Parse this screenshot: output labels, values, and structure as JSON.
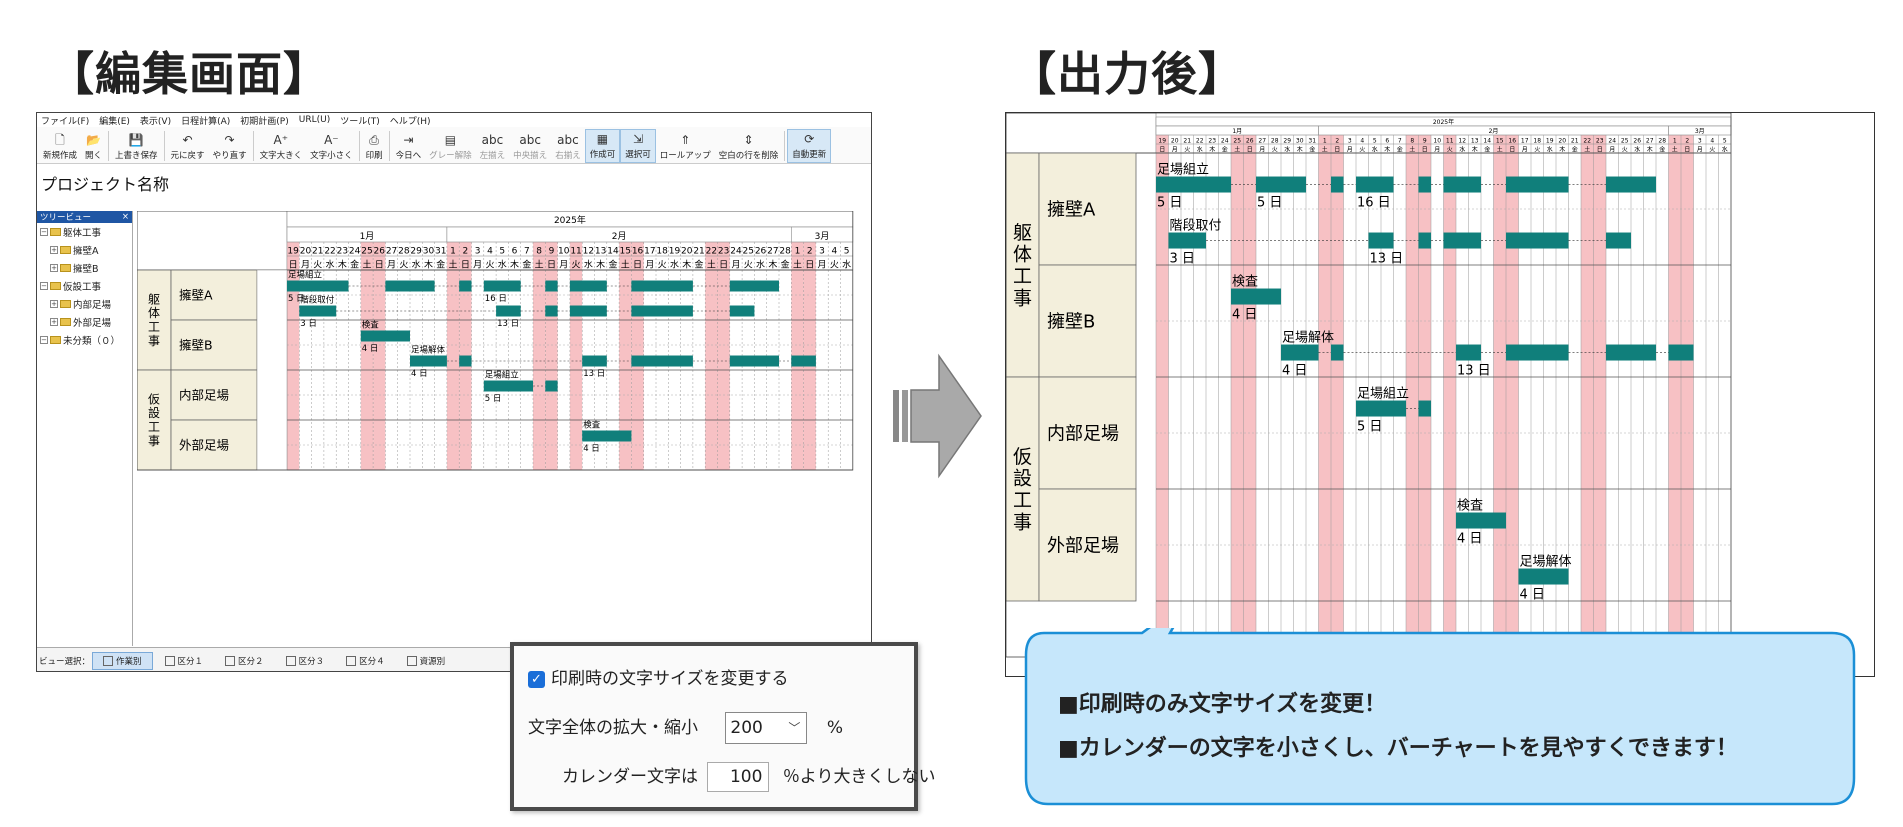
{
  "headings": {
    "left": "【編集画面】",
    "right": "【出力後】"
  },
  "menu": [
    "ファイル(F)",
    "編集(E)",
    "表示(V)",
    "日程計算(A)",
    "初期計画(P)",
    "URL(U)",
    "ツール(T)",
    "ヘルプ(H)"
  ],
  "toolbar": [
    {
      "label": "新規作成",
      "icon": "🗋",
      "state": "normal"
    },
    {
      "label": "開く",
      "icon": "📂",
      "state": "normal"
    },
    {
      "sep": true
    },
    {
      "label": "上書き保存",
      "icon": "💾",
      "state": "normal"
    },
    {
      "sep": true
    },
    {
      "label": "元に戻す",
      "icon": "↶",
      "state": "normal"
    },
    {
      "label": "やり直す",
      "icon": "↷",
      "state": "normal"
    },
    {
      "sep": true
    },
    {
      "label": "文字大きく",
      "icon": "A⁺",
      "state": "normal"
    },
    {
      "label": "文字小さく",
      "icon": "A⁻",
      "state": "normal"
    },
    {
      "sep": true
    },
    {
      "label": "印刷",
      "icon": "⎙",
      "state": "normal"
    },
    {
      "sep": true
    },
    {
      "label": "今日へ",
      "icon": "⇥",
      "state": "normal"
    },
    {
      "label": "グレー解除",
      "icon": "▤",
      "state": "gray"
    },
    {
      "label": "左揃え",
      "icon": "abc",
      "state": "gray"
    },
    {
      "label": "中央揃え",
      "icon": "abc",
      "state": "gray"
    },
    {
      "label": "右揃え",
      "icon": "abc",
      "state": "gray"
    },
    {
      "label": "作成可",
      "icon": "▦",
      "state": "active"
    },
    {
      "label": "選択可",
      "icon": "⇲",
      "state": "active"
    },
    {
      "label": "ロールアップ",
      "icon": "⇑",
      "state": "normal"
    },
    {
      "label": "空白の行を削除",
      "icon": "⇕",
      "state": "normal"
    },
    {
      "sep": true
    },
    {
      "label": "自動更新",
      "icon": "⟳",
      "state": "active"
    }
  ],
  "project_name": "プロジェクト名称",
  "tree": {
    "title": "ツリービュー",
    "close": "×",
    "items": [
      {
        "label": "躯体工事",
        "level": 0,
        "pm": "−"
      },
      {
        "label": "擁壁A",
        "level": 1,
        "pm": "+"
      },
      {
        "label": "擁壁B",
        "level": 1,
        "pm": "+"
      },
      {
        "label": "仮設工事",
        "level": 0,
        "pm": "−"
      },
      {
        "label": "内部足場",
        "level": 1,
        "pm": "+"
      },
      {
        "label": "外部足場",
        "level": 1,
        "pm": "+"
      },
      {
        "label": "未分類（０）",
        "level": 0,
        "pm": "−"
      }
    ]
  },
  "calendar": {
    "year": "2025年",
    "months": [
      {
        "label": "1月",
        "days": 13
      },
      {
        "label": "2月",
        "days": 28
      },
      {
        "label": "3月",
        "days": 5
      }
    ],
    "days": [
      19,
      20,
      21,
      22,
      23,
      24,
      25,
      26,
      27,
      28,
      29,
      30,
      31,
      1,
      2,
      3,
      4,
      5,
      6,
      7,
      8,
      9,
      10,
      11,
      12,
      13,
      14,
      15,
      16,
      17,
      18,
      19,
      20,
      21,
      22,
      23,
      24,
      25,
      26,
      27,
      28,
      1,
      2,
      3,
      4,
      5
    ],
    "weekdays": [
      "日",
      "月",
      "火",
      "水",
      "木",
      "金",
      "土",
      "日",
      "月",
      "火",
      "水",
      "木",
      "金",
      "土",
      "日",
      "月",
      "火",
      "水",
      "木",
      "金",
      "土",
      "日",
      "月",
      "火",
      "水",
      "木",
      "金",
      "土",
      "日",
      "月",
      "火",
      "水",
      "木",
      "金",
      "土",
      "日",
      "月",
      "火",
      "水",
      "木",
      "金",
      "土",
      "日",
      "月",
      "火",
      "水"
    ],
    "holidays": [
      0,
      6,
      7,
      13,
      14,
      20,
      21,
      23,
      27,
      28,
      34,
      35,
      41,
      42
    ]
  },
  "groups": [
    {
      "name": "躯体工事",
      "sub": [
        {
          "name": "擁壁A"
        },
        {
          "name": "擁壁B"
        }
      ]
    },
    {
      "name": "仮設工事",
      "sub": [
        {
          "name": "内部足場"
        },
        {
          "name": "外部足場"
        }
      ]
    }
  ],
  "tasks": [
    {
      "label": "足場組立",
      "dur": "5 日",
      "row": 0,
      "start": 0,
      "segs": [
        [
          0,
          5
        ],
        [
          8,
          12
        ],
        [
          14,
          15
        ],
        [
          16,
          19
        ],
        [
          21,
          22
        ],
        [
          23,
          26
        ],
        [
          28,
          33
        ],
        [
          36,
          40
        ]
      ],
      "dur2": "16 日",
      "dur2_at": 16
    },
    {
      "label": "階段取付",
      "dur": "3 日",
      "row": 1,
      "start": 1,
      "segs": [
        [
          1,
          4
        ],
        [
          17,
          19
        ],
        [
          21,
          22
        ],
        [
          23,
          26
        ],
        [
          28,
          33
        ],
        [
          36,
          38
        ]
      ],
      "dur2": "13 日",
      "dur2_at": 17
    },
    {
      "label": "検査",
      "dur": "4 日",
      "row": 2,
      "start": 6,
      "segs": [
        [
          6,
          10
        ]
      ]
    },
    {
      "label": "足場解体",
      "dur": "4 日",
      "row": 3,
      "start": 10,
      "segs": [
        [
          10,
          13
        ],
        [
          14,
          15
        ],
        [
          24,
          26
        ],
        [
          28,
          33
        ],
        [
          36,
          40
        ],
        [
          41,
          43
        ]
      ],
      "dur2": "13 日",
      "dur2_at": 24
    },
    {
      "label": "足場組立",
      "dur": "5 日",
      "row": 4,
      "start": 16,
      "segs": [
        [
          16,
          20
        ],
        [
          21,
          22
        ]
      ]
    },
    {
      "label": "検査",
      "dur": "4 日",
      "row": 6,
      "start": 24,
      "segs": [
        [
          24,
          28
        ]
      ]
    }
  ],
  "out_tasks": [
    {
      "label": "足場組立",
      "dur": "5 日",
      "row": 0,
      "segs": [
        [
          0,
          6
        ],
        [
          8,
          12
        ],
        [
          14,
          15
        ],
        [
          16,
          19
        ],
        [
          21,
          22
        ],
        [
          23,
          26
        ],
        [
          28,
          33
        ],
        [
          36,
          40
        ]
      ],
      "dur2": "5 日",
      "dur2_at": 8,
      "dur3": "16 日",
      "dur3_at": 16
    },
    {
      "label": "階段取付",
      "dur": "3 日",
      "row": 1,
      "segs": [
        [
          1,
          4
        ],
        [
          17,
          19
        ],
        [
          21,
          22
        ],
        [
          23,
          26
        ],
        [
          28,
          33
        ],
        [
          36,
          38
        ]
      ],
      "dur2": "13 日",
      "dur2_at": 17
    },
    {
      "label": "検査",
      "dur": "4 日",
      "row": 2,
      "segs": [
        [
          6,
          10
        ]
      ]
    },
    {
      "label": "足場解体",
      "dur": "4 日",
      "row": 3,
      "segs": [
        [
          10,
          13
        ],
        [
          14,
          15
        ],
        [
          24,
          26
        ],
        [
          28,
          33
        ],
        [
          36,
          40
        ],
        [
          41,
          43
        ]
      ],
      "dur2": "13 日",
      "dur2_at": 24
    },
    {
      "label": "足場組立",
      "dur": "5 日",
      "row": 4,
      "segs": [
        [
          16,
          20
        ],
        [
          21,
          22
        ]
      ]
    },
    {
      "label": "検査",
      "dur": "4 日",
      "row": 6,
      "segs": [
        [
          24,
          28
        ]
      ]
    },
    {
      "label": "足場解体",
      "dur": "4 日",
      "row": 7,
      "segs": [
        [
          29,
          33
        ]
      ]
    }
  ],
  "status": {
    "label": "ビュー選択：",
    "tabs": [
      {
        "label": "作業別",
        "on": true
      },
      {
        "label": "区分１"
      },
      {
        "label": "区分２"
      },
      {
        "label": "区分３"
      },
      {
        "label": "区分４"
      },
      {
        "label": "資源別"
      }
    ]
  },
  "dialog": {
    "checkbox_label": "印刷時の文字サイズを変更する",
    "scale_label": "文字全体の拡大・縮小",
    "scale_value": "200",
    "scale_unit": "%",
    "cal_label": "カレンダー文字は",
    "cal_value": "100",
    "cal_suffix": "％より大きくしない"
  },
  "bubble": {
    "line1": "■印刷時のみ文字サイズを変更！",
    "line2": "■カレンダーの文字を小さくし、バーチャートを見やすくできます！"
  },
  "colors": {
    "bar": "#107f7b",
    "holiday": "#f7c1c4",
    "header_bg": "#f3efdc",
    "bubble": "#c6e7fb",
    "bubble_border": "#1b8fd6"
  }
}
